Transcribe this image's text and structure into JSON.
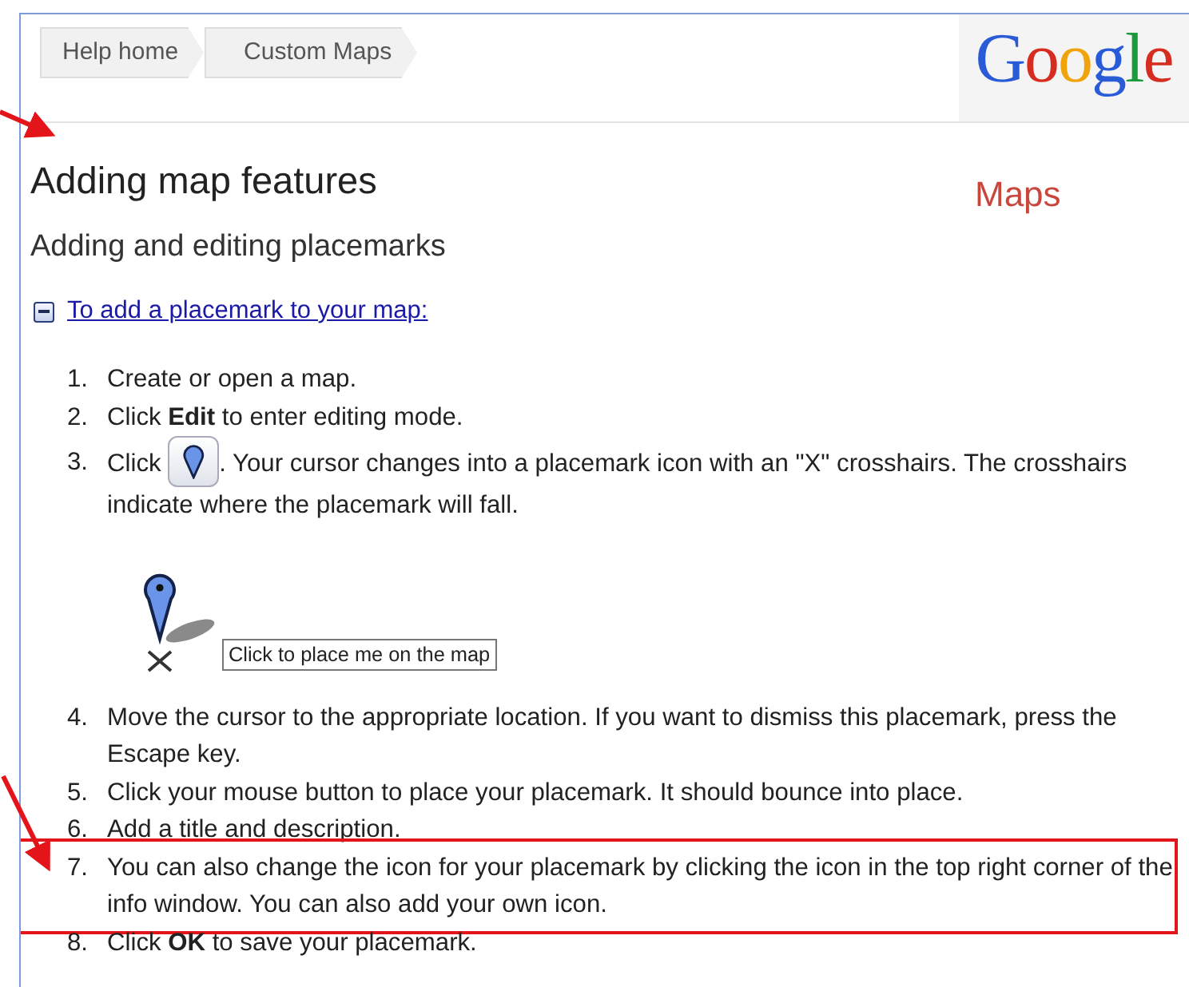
{
  "breadcrumbs": [
    {
      "label": "Help home"
    },
    {
      "label": "Custom Maps"
    }
  ],
  "logo": [
    {
      "letter": "G",
      "color": "#2a5bd7"
    },
    {
      "letter": "o",
      "color": "#d62d20"
    },
    {
      "letter": "o",
      "color": "#f0a30a"
    },
    {
      "letter": "g",
      "color": "#2a5bd7"
    },
    {
      "letter": "l",
      "color": "#1a9a3a"
    },
    {
      "letter": "e",
      "color": "#d62d20"
    }
  ],
  "product": "Maps",
  "title": "Adding map features",
  "subtitle": "Adding and editing placemarks",
  "section": {
    "label": "To add a placemark to your map:",
    "expanded": true
  },
  "steps": [
    {
      "kind": "text",
      "number": "1.",
      "text": "Create or open a map."
    },
    {
      "kind": "text",
      "number": "2.",
      "text": "Click **Edit** to enter editing mode."
    },
    {
      "kind": "button",
      "number": "3.",
      "before": "Click",
      "after": ". Your cursor changes into a placemark icon with an \"X\" crosshairs. The crosshairs indicate where the placemark will fall."
    },
    {
      "kind": "figure",
      "tooltip": "Click to place me on the map"
    },
    {
      "kind": "text",
      "number": "4.",
      "text": "Move the cursor to the appropriate location. If you want to dismiss this placemark, press the Escape key."
    },
    {
      "kind": "text",
      "number": "5.",
      "text": "Click your mouse button to place your placemark. It should bounce into place."
    },
    {
      "kind": "text",
      "number": "6.",
      "text": "Add a title and description."
    },
    {
      "kind": "text",
      "number": "7.",
      "text": "You can also change the icon for your placemark by clicking the icon in the top right corner of the info window. You can also add your own icon.",
      "highlighted": true
    },
    {
      "kind": "text",
      "number": "8.",
      "text": "Click **OK** to save your placemark."
    }
  ]
}
